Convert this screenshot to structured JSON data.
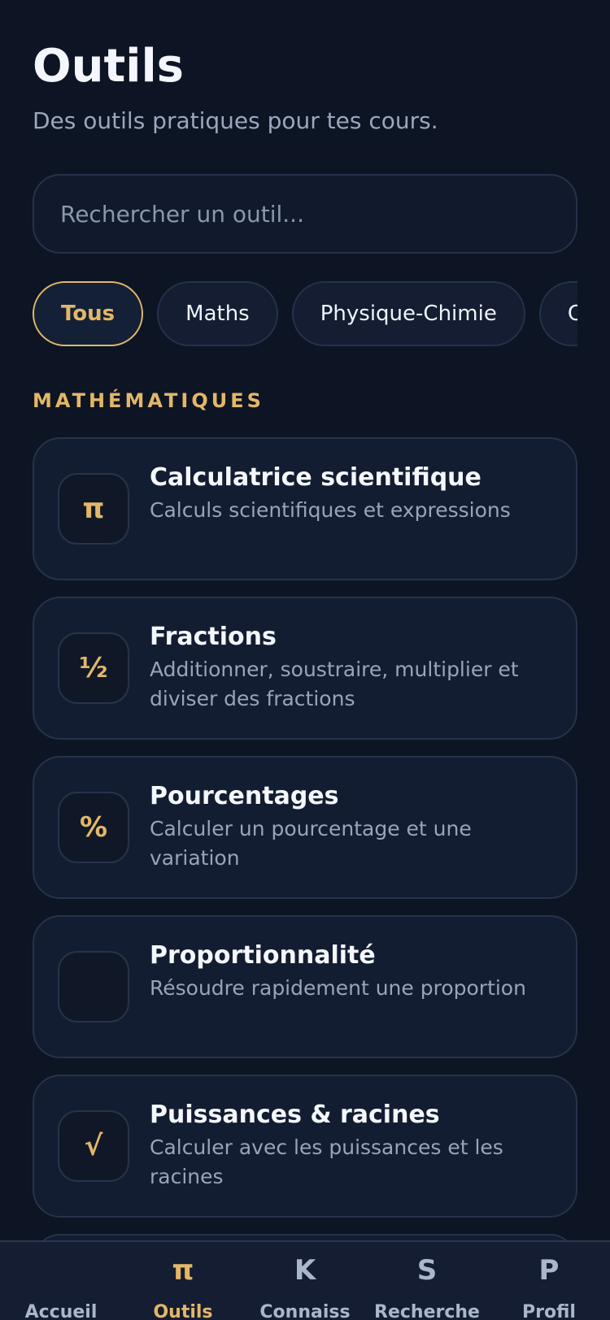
{
  "header": {
    "title": "Outils",
    "subtitle": "Des outils pratiques pour tes cours."
  },
  "search": {
    "placeholder": "Rechercher un outil...",
    "value": ""
  },
  "filters": [
    {
      "label": "Tous",
      "active": true
    },
    {
      "label": "Maths",
      "active": false
    },
    {
      "label": "Physique-Chimie",
      "active": false
    },
    {
      "label": "Con",
      "active": false
    }
  ],
  "sections": [
    {
      "title": "MATHÉMATIQUES",
      "tools": [
        {
          "icon": "π",
          "icon_name": "pi-icon",
          "title": "Calculatrice scientifique",
          "description": "Calculs scientifiques et expressions"
        },
        {
          "icon": "½",
          "icon_name": "fraction-icon",
          "title": "Fractions",
          "description": "Additionner, soustraire, multiplier et diviser des fractions"
        },
        {
          "icon": "%",
          "icon_name": "percent-icon",
          "title": "Pourcentages",
          "description": "Calculer un pourcentage et une variation"
        },
        {
          "icon": "",
          "icon_name": "proportion-icon",
          "title": "Proportionnalité",
          "description": "Résoudre rapidement une proportion"
        },
        {
          "icon": "√",
          "icon_name": "square-root-icon",
          "title": "Puissances & racines",
          "description": "Calculer avec les puissances et les racines"
        }
      ]
    }
  ],
  "bottom_nav": [
    {
      "icon": "",
      "icon_name": "home-icon",
      "label": "Accueil",
      "active": false
    },
    {
      "icon": "π",
      "icon_name": "pi-icon",
      "label": "Outils",
      "active": true
    },
    {
      "icon": "K",
      "icon_name": "k-icon",
      "label": "Connaiss",
      "active": false
    },
    {
      "icon": "S",
      "icon_name": "s-icon",
      "label": "Recherche",
      "active": false
    },
    {
      "icon": "P",
      "icon_name": "p-icon",
      "label": "Profil",
      "active": false
    }
  ],
  "colors": {
    "background": "#0d1424",
    "card": "#131d31",
    "border": "#263349",
    "accent": "#e3b767",
    "muted_text": "#97a4b9",
    "primary_text": "#f3f6fc"
  }
}
